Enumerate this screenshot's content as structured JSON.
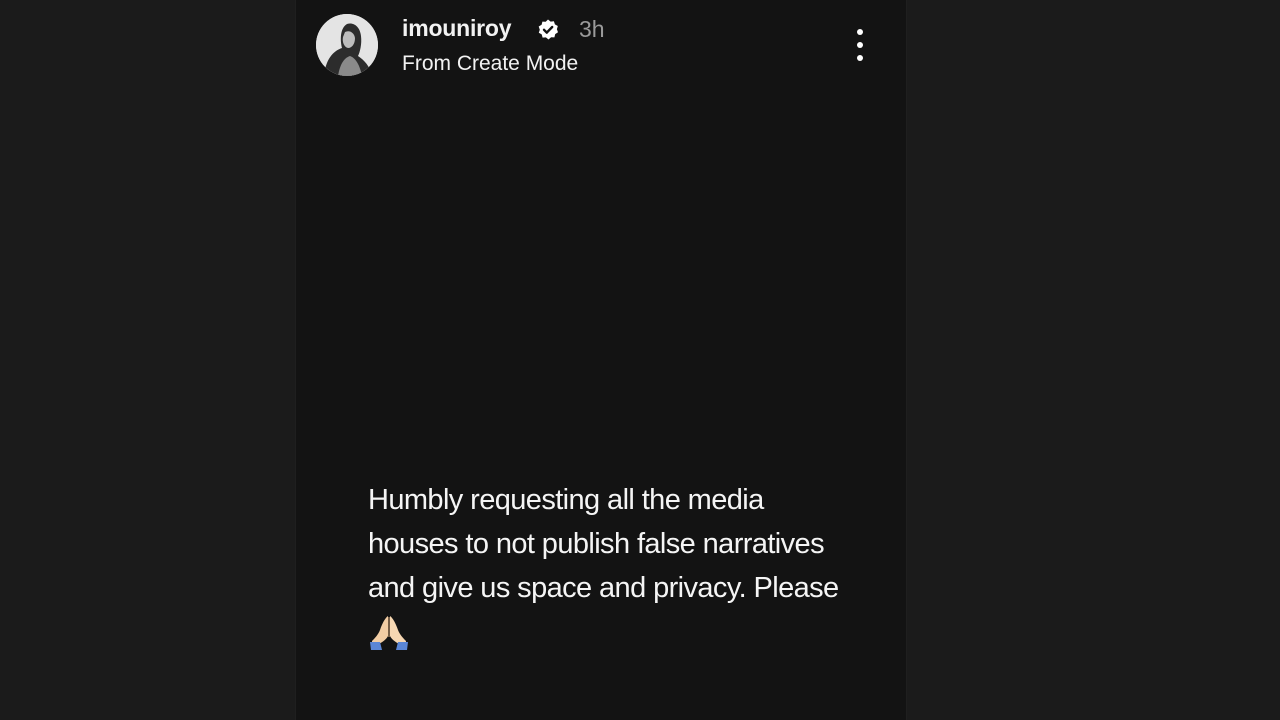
{
  "story": {
    "username": "imouniroy",
    "verified_icon": "verified-badge-icon",
    "timestamp": "3h",
    "subtitle": "From Create Mode",
    "menu_icon": "more-vertical-icon",
    "text": "Humbly requesting all the media houses to not publish false narratives and give us space and privacy. Please",
    "emoji_icon": "folded-hands-icon"
  },
  "colors": {
    "page_background": "#1b1b1b",
    "story_background": "#131313",
    "text_primary": "#f2f2f2",
    "text_secondary": "#9a9a9a"
  }
}
